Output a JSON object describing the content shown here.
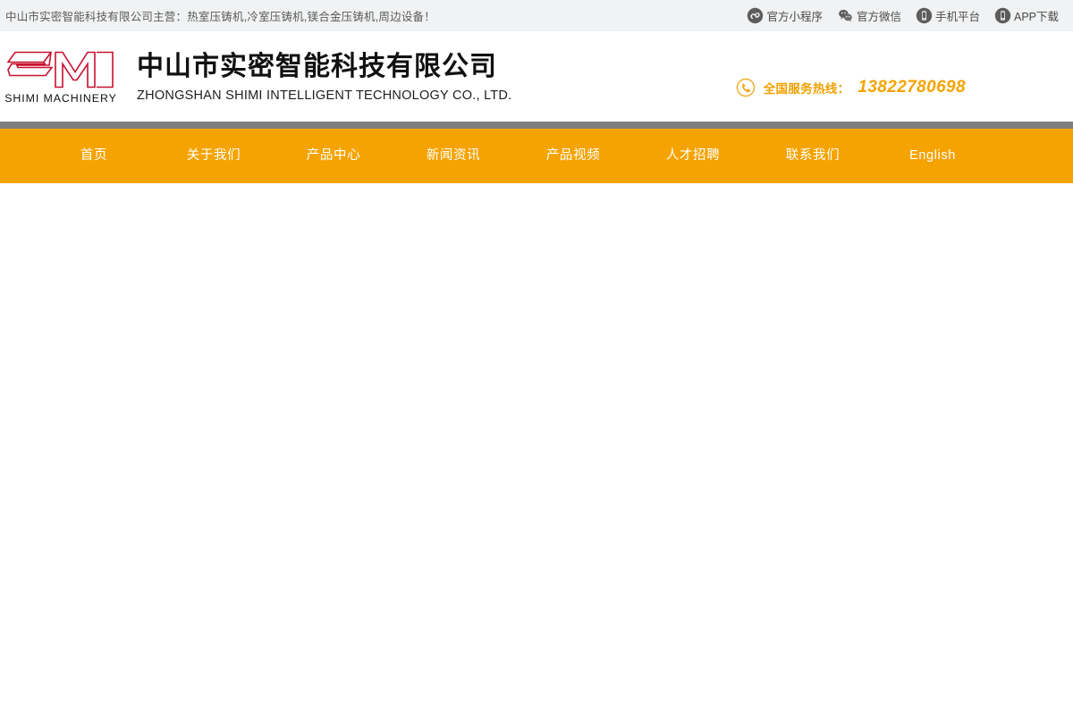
{
  "topbar": {
    "slogan": "中山市实密智能科技有限公司主营：热室压铸机,冷室压铸机,镁合金压铸机,周边设备！",
    "links": [
      {
        "label": "官方小程序",
        "icon": "miniprogram-icon"
      },
      {
        "label": "官方微信",
        "icon": "wechat-icon"
      },
      {
        "label": "手机平台",
        "icon": "mobile-phone-icon"
      },
      {
        "label": "APP下载",
        "icon": "app-download-icon"
      }
    ]
  },
  "header": {
    "logo": {
      "mark": "sm-monogram-icon",
      "wordmark": "SHIMI MACHINERY"
    },
    "company_cn": "中山市实密智能科技有限公司",
    "company_en": "ZHONGSHAN SHIMI INTELLIGENT TECHNOLOGY CO., LTD.",
    "hotline": {
      "icon": "phone-circle-icon",
      "label": "全国服务热线：",
      "number": "13822780698"
    }
  },
  "nav": {
    "items": [
      {
        "label": "首页"
      },
      {
        "label": "关于我们"
      },
      {
        "label": "产品中心"
      },
      {
        "label": "新闻资讯"
      },
      {
        "label": "产品视频"
      },
      {
        "label": "人才招聘"
      },
      {
        "label": "联系我们"
      },
      {
        "label": "English"
      }
    ]
  },
  "colors": {
    "accent_orange": "#f5a300",
    "divider_gray": "#7f7f7f",
    "topbar_bg": "#f1f2f3",
    "logo_red": "#c8102e"
  }
}
